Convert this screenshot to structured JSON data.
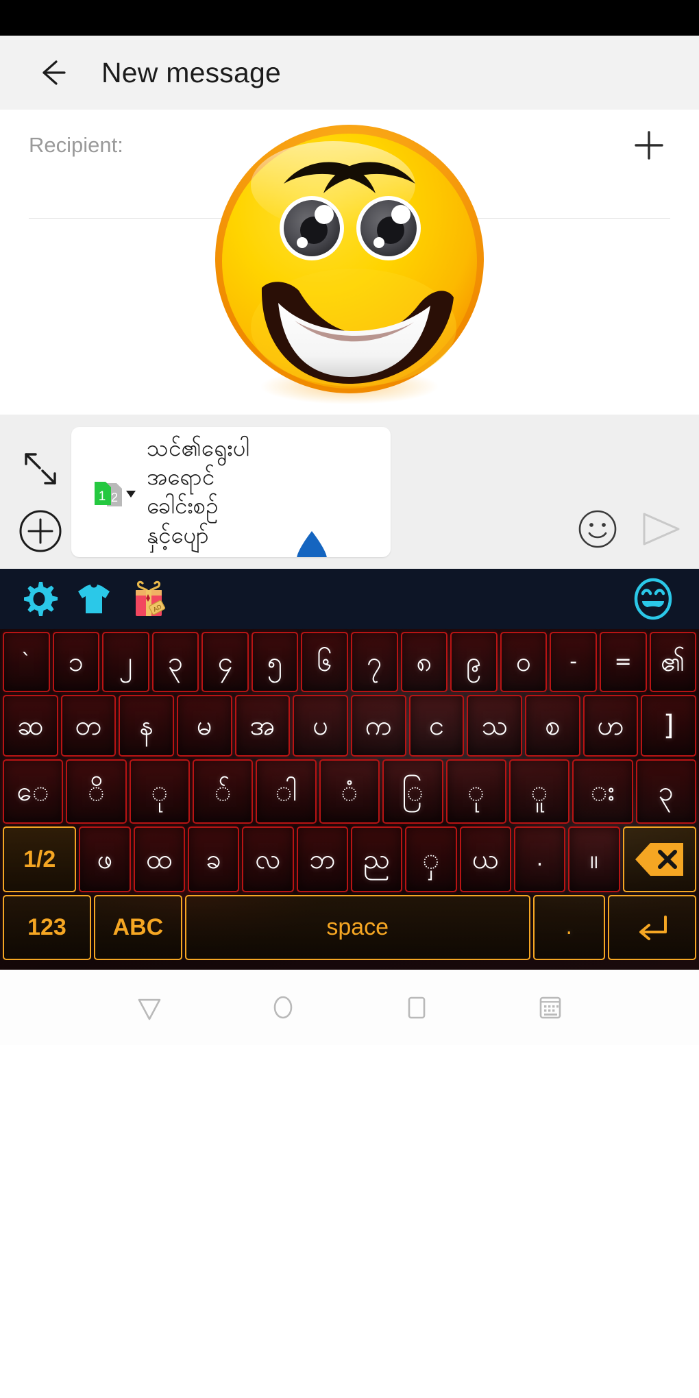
{
  "statusbar": {
    "height_note": "black"
  },
  "appbar": {
    "back_icon": "arrow-left-icon",
    "title": "New message"
  },
  "compose": {
    "recipient_label": "Recipient:",
    "recipient_value": "",
    "add_contact_icon": "plus-icon",
    "sticker": "smiling-face-sticker"
  },
  "input_bar": {
    "resize_icon": "expand-collapse-icon",
    "add_icon": "plus-circle-icon",
    "sim_badge": {
      "active": "1",
      "inactive": "2",
      "dropdown_icon": "chevron-down-icon"
    },
    "message_lines": [
      "သင်၏ရွေးပါ",
      "အရောင်",
      "ခေါင်းစဉ်",
      "နှင့်ပျော်"
    ],
    "message_emoji": "droplet-emoji",
    "emoji_button_icon": "smiley-icon",
    "send_button_icon": "send-icon"
  },
  "keyboard_toolbar": {
    "icons": [
      "gear-icon",
      "tshirt-icon",
      "gift-icon"
    ],
    "right_icon": "laughing-face-icon",
    "accent": "#2bc8e8",
    "background": "#0d1526"
  },
  "keyboard": {
    "rows": [
      {
        "name": "row-digits",
        "keys": [
          {
            "label": "`",
            "type": "red"
          },
          {
            "label": "၁",
            "type": "red"
          },
          {
            "label": "၂",
            "type": "red"
          },
          {
            "label": "၃",
            "type": "red"
          },
          {
            "label": "၄",
            "type": "red"
          },
          {
            "label": "၅",
            "type": "red"
          },
          {
            "label": "၆",
            "type": "red"
          },
          {
            "label": "၇",
            "type": "red"
          },
          {
            "label": "၈",
            "type": "red"
          },
          {
            "label": "၉",
            "type": "red"
          },
          {
            "label": "၀",
            "type": "red"
          },
          {
            "label": "-",
            "type": "red"
          },
          {
            "label": "=",
            "type": "red"
          },
          {
            "label": "၏",
            "type": "red"
          }
        ]
      },
      {
        "name": "row-consonants-1",
        "keys": [
          {
            "label": "ဆ",
            "type": "red"
          },
          {
            "label": "တ",
            "type": "red"
          },
          {
            "label": "န",
            "type": "red"
          },
          {
            "label": "မ",
            "type": "red"
          },
          {
            "label": "အ",
            "type": "red"
          },
          {
            "label": "ပ",
            "type": "red"
          },
          {
            "label": "က",
            "type": "red"
          },
          {
            "label": "င",
            "type": "red"
          },
          {
            "label": "သ",
            "type": "red"
          },
          {
            "label": "စ",
            "type": "red"
          },
          {
            "label": "ဟ",
            "type": "red"
          },
          {
            "label": "]",
            "type": "red"
          }
        ]
      },
      {
        "name": "row-vowels",
        "keys": [
          {
            "label": "ေ",
            "type": "red"
          },
          {
            "label": "ိ",
            "type": "red"
          },
          {
            "label": "ု",
            "type": "red"
          },
          {
            "label": "်",
            "type": "red"
          },
          {
            "label": "ါ",
            "type": "red"
          },
          {
            "label": "ံ",
            "type": "red"
          },
          {
            "label": "ြ",
            "type": "red"
          },
          {
            "label": "ု",
            "type": "red"
          },
          {
            "label": "ူ",
            "type": "red"
          },
          {
            "label": "း",
            "type": "red"
          },
          {
            "label": "၃",
            "type": "red"
          }
        ]
      },
      {
        "name": "row-shift",
        "keys": [
          {
            "label": "1/2",
            "type": "orange",
            "wide": 1.45
          },
          {
            "label": "ဖ",
            "type": "red"
          },
          {
            "label": "ထ",
            "type": "red"
          },
          {
            "label": "ခ",
            "type": "red"
          },
          {
            "label": "လ",
            "type": "red"
          },
          {
            "label": "ဘ",
            "type": "red"
          },
          {
            "label": "ည",
            "type": "red"
          },
          {
            "label": "ှ",
            "type": "red"
          },
          {
            "label": "ယ",
            "type": "red"
          },
          {
            "label": ".",
            "type": "red"
          },
          {
            "label": "။",
            "type": "red"
          },
          {
            "label": "",
            "type": "orange",
            "icon": "backspace-icon",
            "wide": 1.45
          }
        ]
      },
      {
        "name": "row-bottom",
        "keys": [
          {
            "label": "123",
            "type": "dark",
            "wide": 1.6
          },
          {
            "label": "ABC",
            "type": "dark",
            "wide": 1.6
          },
          {
            "label": "space",
            "type": "dark",
            "wide": 6.4
          },
          {
            "label": ".",
            "type": "dark",
            "wide": 1.3
          },
          {
            "label": "",
            "type": "dark",
            "icon": "enter-icon",
            "wide": 1.6
          }
        ]
      }
    ],
    "accent_red": "#b81414",
    "accent_orange": "#f5a623"
  },
  "navbar": {
    "buttons": [
      "back-triangle-icon",
      "home-circle-icon",
      "recents-square-icon",
      "keyboard-icon"
    ]
  }
}
